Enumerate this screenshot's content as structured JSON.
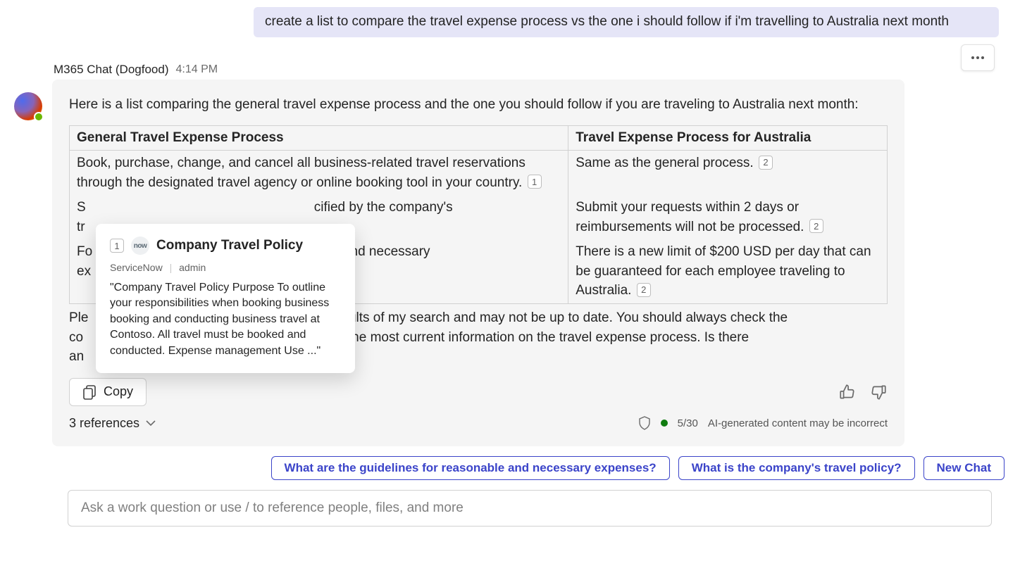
{
  "user_message": {
    "text": "create a list to compare the travel expense process vs the one i should follow if i'm travelling to Australia next month"
  },
  "bot_header": {
    "name": "M365 Chat (Dogfood)",
    "time": "4:14 PM"
  },
  "response": {
    "intro": "Here is a list comparing the general travel expense process and the one you should follow if you are traveling to Australia next month:",
    "table": {
      "col1_header": "General Travel Expense Process",
      "col2_header": "Travel Expense Process for Australia",
      "rows": [
        {
          "left": "Book, purchase, change, and cancel all business-related travel reservations through the designated travel agency or online booking tool in your country.",
          "left_cite": "1",
          "right": "Same as the general process.",
          "right_cite": "2"
        },
        {
          "left_prefix": "S",
          "left_mid": "cified by the company's",
          "left_prefix2": "tr",
          "right": "Submit your requests within 2 days or reimbursements will not be processed.",
          "right_cite": "2"
        },
        {
          "left_prefix": "Fo",
          "left_mid": "able and necessary",
          "left_prefix2": "ex",
          "right": "There is a new limit of $200 USD per day that can be guaranteed for each employee traveling to Australia.",
          "right_cite": "2"
        }
      ]
    },
    "disclaimer_prefix": "Ple",
    "disclaimer_mid": "n the results of my search and may not be up to date. You should always check the",
    "disclaimer_prefix2": "co",
    "disclaimer_mid2": "tment for the most current information on the travel expense process. Is there",
    "disclaimer_prefix3": "an"
  },
  "copy_label": "Copy",
  "references": {
    "label": "3 references"
  },
  "footer": {
    "count": "5/30",
    "notice": "AI-generated content may be incorrect"
  },
  "suggestions": [
    "What are the guidelines for reasonable and necessary expenses?",
    "What is the company's travel policy?",
    "New Chat"
  ],
  "input": {
    "placeholder": "Ask a work question or use / to reference people, files, and more"
  },
  "tooltip": {
    "cite": "1",
    "app_short": "now",
    "title": "Company Travel Policy",
    "source": "ServiceNow",
    "author": "admin",
    "body": "\"Company Travel Policy Purpose To outline your responsibilities when booking business booking and conducting business travel at Contoso. All travel must be booked and conducted. Expense management Use ...\""
  }
}
